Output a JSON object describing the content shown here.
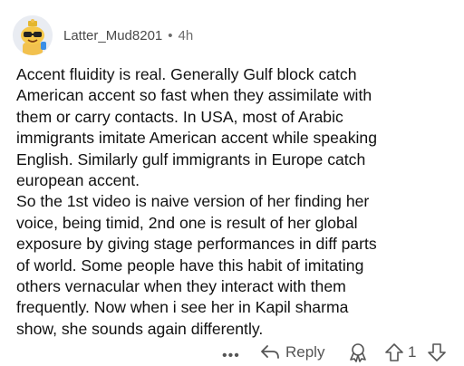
{
  "comment": {
    "username": "Latter_Mud8201",
    "separator": "•",
    "age": "4h",
    "lines": [
      "Accent fluidity is real. Generally Gulf block catch",
      "American accent so fast when they assimilate with",
      "them or carry contacts. In USA, most of Arabic",
      "immigrants imitate American accent while speaking",
      "English. Similarly gulf immigrants in Europe catch",
      "european accent.",
      "So the 1st video is naive version of her finding her",
      "voice, being timid, 2nd one is result of her global",
      "exposure by giving stage performances in diff parts",
      "of world. Some people have this habit of imitating",
      "others vernacular when they interact with them",
      "frequently. Now when i see her in Kapil sharma",
      "show, she sounds again differently."
    ]
  },
  "actions": {
    "more_label": "•••",
    "reply_label": "Reply",
    "vote_count": "1"
  },
  "icons": {
    "avatar": "snoo-avatar-with-sunglasses",
    "reply": "reply-arrow-icon",
    "award": "award-icon",
    "upvote": "upvote-arrow-icon",
    "downvote": "downvote-arrow-icon"
  }
}
